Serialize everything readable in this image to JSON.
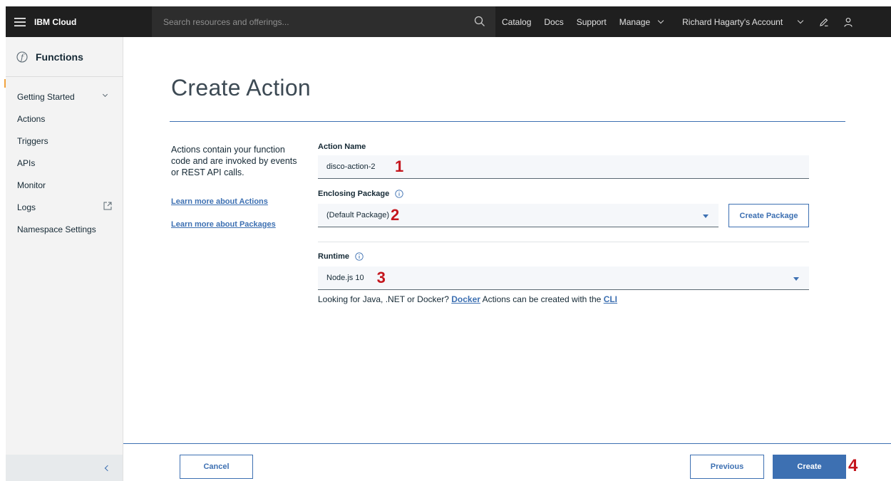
{
  "topbar": {
    "brand": "IBM Cloud",
    "search_placeholder": "Search resources and offerings...",
    "nav": [
      "Catalog",
      "Docs",
      "Support",
      "Manage"
    ],
    "account": "Richard Hagarty's Account"
  },
  "sidebar": {
    "title": "Functions",
    "items": [
      "Getting Started",
      "Actions",
      "Triggers",
      "APIs",
      "Monitor",
      "Logs",
      "Namespace Settings"
    ]
  },
  "main": {
    "title": "Create Action",
    "description": "Actions contain your function code and are invoked by events or REST API calls.",
    "links": [
      "Learn more about Actions",
      "Learn more about Packages"
    ],
    "action_name_label": "Action Name",
    "action_name_value": "disco-action-2",
    "package_label": "Enclosing Package",
    "package_value": "(Default Package)",
    "create_package_label": "Create Package",
    "runtime_label": "Runtime",
    "runtime_value": "Node.js 10",
    "helper_prefix": "Looking for Java, .NET or Docker?",
    "helper_link_docker": "Docker",
    "helper_middle": "Actions can be created with the",
    "helper_link_cli": "CLI"
  },
  "annotations": [
    "1",
    "2",
    "3",
    "4"
  ],
  "footer": {
    "cancel_label": "Cancel",
    "previous_label": "Previous",
    "create_label": "Create"
  },
  "colors": {
    "topbar": "#1f1f1f",
    "accent": "#3d70b2",
    "annotation": "#c4151c"
  }
}
